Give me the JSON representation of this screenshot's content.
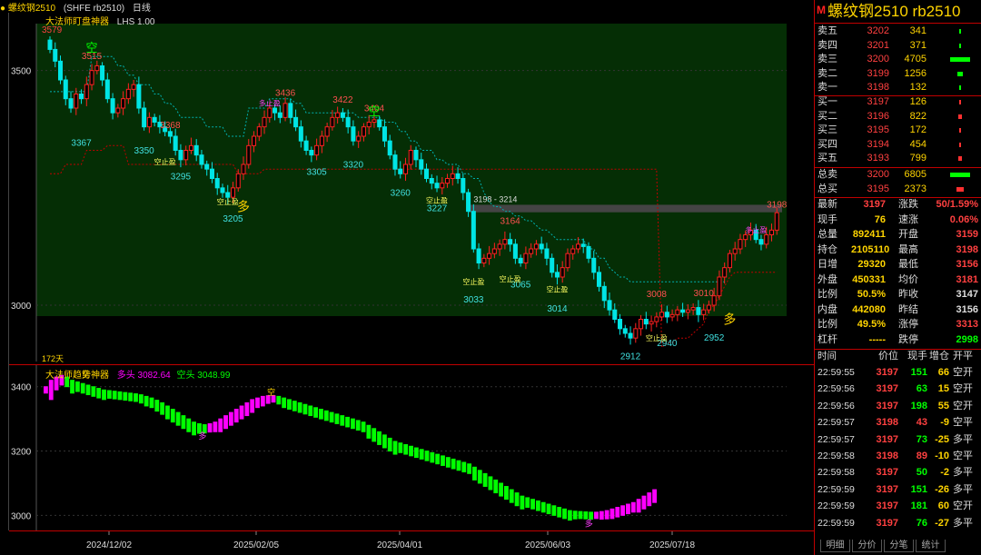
{
  "topbar": {
    "symbol": "● 螺纹钢2510",
    "sup": "M",
    "code": "(SHFE rb2510)",
    "period": "日线"
  },
  "main_legend": {
    "name": "大法师盯盘神器",
    "lhs": "LHS 1.00"
  },
  "sub_legend": {
    "name": "大法师趋势神器",
    "bull_label": "多头 3082.64",
    "bear_label": "空头 3048.99"
  },
  "main_axis": {
    "labels": [
      "3500",
      "3000"
    ],
    "values": [
      3500,
      3000
    ],
    "min": 2880,
    "max": 3600
  },
  "sub_axis": {
    "labels": [
      "3400",
      "3200",
      "3000"
    ],
    "values": [
      3400,
      3200,
      3000
    ],
    "min": 2970,
    "max": 3450
  },
  "date_axis": [
    "2024/12/02",
    "2025/02/05",
    "2025/04/01",
    "2025/06/03",
    "2025/07/18"
  ],
  "chart_annotations": {
    "top_left_price": "3579",
    "days_label": "172天",
    "zone_label": "3198 - 3214",
    "highs": [
      {
        "i": 8,
        "v": "3515"
      },
      {
        "i": 23,
        "v": "3368"
      },
      {
        "i": 45,
        "v": "3436"
      },
      {
        "i": 56,
        "v": "3422"
      },
      {
        "i": 62,
        "v": "3404"
      },
      {
        "i": 88,
        "v": "3164"
      },
      {
        "i": 116,
        "v": "3008"
      },
      {
        "i": 125,
        "v": "3010"
      },
      {
        "i": 139,
        "v": "3198"
      }
    ],
    "lows": [
      {
        "i": 6,
        "v": "3367"
      },
      {
        "i": 18,
        "v": "3350"
      },
      {
        "i": 25,
        "v": "3295"
      },
      {
        "i": 35,
        "v": "3205"
      },
      {
        "i": 51,
        "v": "3305"
      },
      {
        "i": 58,
        "v": "3320"
      },
      {
        "i": 67,
        "v": "3260"
      },
      {
        "i": 74,
        "v": "3227"
      },
      {
        "i": 81,
        "v": "3033"
      },
      {
        "i": 90,
        "v": "3065"
      },
      {
        "i": 97,
        "v": "3014"
      },
      {
        "i": 111,
        "v": "2912"
      },
      {
        "i": 118,
        "v": "2940"
      },
      {
        "i": 127,
        "v": "2952"
      }
    ],
    "signals": {
      "kong": "空",
      "duo": "多",
      "kong_stop": "空止盈",
      "duo_stop": "多止盈"
    }
  },
  "panel": {
    "title": "螺纹钢2510  rb2510",
    "logo": "M",
    "asks": [
      {
        "label": "卖五",
        "price": "3202",
        "vol": "341",
        "bar": 0.05
      },
      {
        "label": "卖四",
        "price": "3201",
        "vol": "371",
        "bar": 0.05
      },
      {
        "label": "卖三",
        "price": "3200",
        "vol": "4705",
        "bar": 0.6
      },
      {
        "label": "卖二",
        "price": "3199",
        "vol": "1256",
        "bar": 0.16
      },
      {
        "label": "卖一",
        "price": "3198",
        "vol": "132",
        "bar": 0.03
      }
    ],
    "bids": [
      {
        "label": "买一",
        "price": "3197",
        "vol": "126",
        "bar": 0.03
      },
      {
        "label": "买二",
        "price": "3196",
        "vol": "822",
        "bar": 0.1
      },
      {
        "label": "买三",
        "price": "3195",
        "vol": "172",
        "bar": 0.03
      },
      {
        "label": "买四",
        "price": "3194",
        "vol": "454",
        "bar": 0.06
      },
      {
        "label": "买五",
        "price": "3193",
        "vol": "799",
        "bar": 0.1
      }
    ],
    "totals": [
      {
        "label": "总卖",
        "price": "3200",
        "vol": "6805",
        "bar": 0.6,
        "color": "#00ff00"
      },
      {
        "label": "总买",
        "price": "3195",
        "vol": "2373",
        "bar": 0.2,
        "color": "#ff3030"
      }
    ],
    "quote": [
      {
        "k1": "最新",
        "v1": "3197",
        "c1": "#ff4040",
        "k2": "涨跌",
        "v2": "50/1.59%",
        "c2": "#ff4040"
      },
      {
        "k1": "现手",
        "v1": "76",
        "c1": "#ffd400",
        "k2": "速涨",
        "v2": "0.06%",
        "c2": "#ff4040"
      },
      {
        "k1": "总量",
        "v1": "892411",
        "c1": "#ffd400",
        "k2": "开盘",
        "v2": "3159",
        "c2": "#ff4040"
      },
      {
        "k1": "持仓",
        "v1": "2105110",
        "c1": "#ffd400",
        "k2": "最高",
        "v2": "3198",
        "c2": "#ff4040"
      },
      {
        "k1": "日增",
        "v1": "29320",
        "c1": "#ffd400",
        "k2": "最低",
        "v2": "3156",
        "c2": "#ff4040"
      },
      {
        "k1": "外盘",
        "v1": "450331",
        "c1": "#ffd400",
        "k2": "均价",
        "v2": "3181",
        "c2": "#ff4040"
      },
      {
        "k1": "比例",
        "v1": "50.5%",
        "c1": "#ffd400",
        "k2": "昨收",
        "v2": "3147",
        "c2": "#ddd"
      },
      {
        "k1": "内盘",
        "v1": "442080",
        "c1": "#ffd400",
        "k2": "昨结",
        "v2": "3156",
        "c2": "#ddd"
      },
      {
        "k1": "比例",
        "v1": "49.5%",
        "c1": "#ffd400",
        "k2": "涨停",
        "v2": "3313",
        "c2": "#ff4040"
      },
      {
        "k1": "杠杆",
        "v1": "-----",
        "c1": "#ffd400",
        "k2": "跌停",
        "v2": "2998",
        "c2": "#00ff00"
      }
    ],
    "ticks_header": [
      "时间",
      "价位",
      "现手",
      "增仓",
      "开平"
    ],
    "ticks": [
      {
        "t": "22:59:55",
        "p": "3197",
        "pc": "#ff4040",
        "v": "151",
        "vc": "#00ff00",
        "d": "66",
        "e": "空开"
      },
      {
        "t": "22:59:56",
        "p": "3197",
        "pc": "#ff4040",
        "v": "63",
        "vc": "#00ff00",
        "d": "15",
        "e": "空开"
      },
      {
        "t": "22:59:56",
        "p": "3197",
        "pc": "#ff4040",
        "v": "198",
        "vc": "#00ff00",
        "d": "55",
        "e": "空开"
      },
      {
        "t": "22:59:57",
        "p": "3198",
        "pc": "#ff4040",
        "v": "43",
        "vc": "#ff4040",
        "d": "-9",
        "e": "空平"
      },
      {
        "t": "22:59:57",
        "p": "3197",
        "pc": "#ff4040",
        "v": "73",
        "vc": "#00ff00",
        "d": "-25",
        "e": "多平"
      },
      {
        "t": "22:59:58",
        "p": "3198",
        "pc": "#ff4040",
        "v": "89",
        "vc": "#ff4040",
        "d": "-10",
        "e": "空平"
      },
      {
        "t": "22:59:58",
        "p": "3197",
        "pc": "#ff4040",
        "v": "50",
        "vc": "#00ff00",
        "d": "-2",
        "e": "多平"
      },
      {
        "t": "22:59:59",
        "p": "3197",
        "pc": "#ff4040",
        "v": "151",
        "vc": "#00ff00",
        "d": "-26",
        "e": "多平"
      },
      {
        "t": "22:59:59",
        "p": "3197",
        "pc": "#ff4040",
        "v": "181",
        "vc": "#00ff00",
        "d": "60",
        "e": "空开"
      },
      {
        "t": "22:59:59",
        "p": "3197",
        "pc": "#ff4040",
        "v": "76",
        "vc": "#00ff00",
        "d": "-27",
        "e": "多平"
      }
    ],
    "tabs": [
      "明细",
      "分价",
      "分笔",
      "统计"
    ]
  },
  "colors": {
    "bg_green": "#052e05",
    "up": "#ff2020",
    "down": "#00e5e5",
    "stop": "#c00000",
    "bull": "#ff00ff",
    "bear": "#00ff00"
  },
  "chart_data": {
    "type": "candlestick",
    "closes": [
      3545,
      3520,
      3480,
      3440,
      3420,
      3450,
      3440,
      3470,
      3500,
      3510,
      3480,
      3440,
      3410,
      3420,
      3440,
      3460,
      3470,
      3420,
      3380,
      3400,
      3390,
      3380,
      3370,
      3360,
      3330,
      3310,
      3330,
      3340,
      3320,
      3300,
      3290,
      3270,
      3250,
      3240,
      3230,
      3250,
      3280,
      3300,
      3340,
      3360,
      3380,
      3400,
      3420,
      3410,
      3400,
      3430,
      3400,
      3380,
      3350,
      3330,
      3320,
      3340,
      3360,
      3380,
      3400,
      3410,
      3400,
      3380,
      3350,
      3360,
      3380,
      3390,
      3395,
      3380,
      3350,
      3320,
      3290,
      3280,
      3300,
      3330,
      3310,
      3290,
      3270,
      3260,
      3250,
      3260,
      3270,
      3280,
      3270,
      3240,
      3200,
      3120,
      3090,
      3100,
      3110,
      3120,
      3130,
      3140,
      3130,
      3100,
      3090,
      3110,
      3120,
      3130,
      3120,
      3100,
      3070,
      3060,
      3080,
      3110,
      3120,
      3130,
      3125,
      3100,
      3070,
      3040,
      3010,
      2990,
      2970,
      2950,
      2940,
      2930,
      2950,
      2970,
      2960,
      2965,
      2975,
      2985,
      2975,
      2980,
      2990,
      2985,
      2990,
      2995,
      2980,
      2990,
      3000,
      3020,
      3060,
      3080,
      3110,
      3120,
      3140,
      3150,
      3160,
      3140,
      3130,
      3150,
      3160,
      3197
    ],
    "stop_line_bear": [
      3455,
      3455,
      3455,
      3455,
      3455,
      3455,
      3455,
      3455,
      3530,
      3530,
      3530,
      3530,
      3530,
      3510,
      3510,
      3490,
      3490,
      3470,
      3470,
      3470,
      3450,
      3450,
      3430,
      3430,
      3420,
      3400,
      3400,
      3400,
      3400,
      3400,
      3380,
      3380,
      3380,
      3380,
      3360,
      3360,
      3360,
      3360,
      3420,
      3420,
      3420,
      3420,
      3440,
      3440,
      3440,
      3440,
      3440,
      3430,
      3430,
      3410,
      3410,
      3410,
      3410,
      3410,
      3410,
      3410,
      3410,
      3410,
      3410,
      3400,
      3400,
      3400,
      3400,
      3400,
      3390,
      3390,
      3390,
      3370,
      3370,
      3350,
      3350,
      3330,
      3330,
      3330,
      3310,
      3310,
      3300,
      3300,
      3300,
      3280,
      3280,
      3270,
      3270,
      3240,
      3220,
      3210,
      3210,
      3200,
      3200,
      3190,
      3190,
      3180,
      3180,
      3170,
      3160,
      3160,
      3150,
      3140,
      3140,
      3140,
      3140,
      3140,
      3140,
      3120,
      3120,
      3100,
      3100,
      3080,
      3070,
      3060,
      3060,
      3050,
      3050,
      3050,
      3050,
      3050,
      3050,
      3050,
      3050,
      3050,
      3050,
      3050,
      3050,
      3050,
      3050,
      3050,
      3050,
      3050,
      3050,
      3050
    ],
    "stop_line_bull": [
      3280,
      3280,
      3280,
      3300,
      3300,
      3300,
      3300,
      3330,
      3330,
      3330,
      3330,
      3340,
      3340,
      3340,
      3340,
      3300,
      3300,
      3300,
      3300,
      3300,
      3300,
      3300,
      3300,
      3300,
      3300,
      3300,
      3300,
      3300,
      3300,
      3300,
      3300,
      3300,
      3300,
      3300,
      3300,
      3300,
      3280,
      3280,
      3280,
      3280,
      3280,
      3290,
      3290,
      3290,
      3290,
      3290,
      3290,
      3290,
      3290,
      3290,
      3290,
      3290,
      3290,
      3290,
      3290,
      3290,
      3290,
      3290,
      3290,
      3290,
      3290,
      3290,
      3290,
      3290,
      3290,
      3290,
      3290,
      3290,
      3290,
      3290,
      3290,
      3290,
      3290,
      3290,
      3290,
      3290,
      3290,
      3290,
      3290,
      3290,
      3290,
      3290,
      3290,
      3290,
      3290,
      3290,
      3290,
      3290,
      3290,
      3290,
      3290,
      3290,
      3290,
      3290,
      3290,
      3290,
      3290,
      3290,
      3290,
      3290,
      3290,
      3290,
      3290,
      3290,
      3290,
      3290,
      3290,
      3290,
      3290,
      3290,
      3290,
      3290,
      3290,
      3290,
      3290,
      3290,
      3290,
      2910,
      2920,
      2920,
      2930,
      2930,
      2930,
      2940,
      2950,
      2960,
      2990,
      3000,
      3020,
      3040,
      3060,
      3070,
      3070,
      3070,
      3070,
      3070,
      3070,
      3070,
      3070,
      3070,
      3070
    ],
    "trend": [
      3390,
      3410,
      3420,
      3425,
      3420,
      3410,
      3405,
      3400,
      3395,
      3390,
      3385,
      3380,
      3378,
      3376,
      3374,
      3372,
      3370,
      3368,
      3365,
      3360,
      3355,
      3348,
      3340,
      3330,
      3320,
      3310,
      3300,
      3290,
      3280,
      3275,
      3272,
      3275,
      3280,
      3290,
      3300,
      3310,
      3320,
      3330,
      3340,
      3350,
      3355,
      3360,
      3362,
      3362,
      3360,
      3355,
      3350,
      3345,
      3340,
      3335,
      3330,
      3325,
      3320,
      3315,
      3310,
      3305,
      3300,
      3295,
      3290,
      3285,
      3280,
      3270,
      3260,
      3250,
      3240,
      3230,
      3220,
      3215,
      3210,
      3205,
      3200,
      3195,
      3190,
      3185,
      3180,
      3175,
      3170,
      3165,
      3160,
      3155,
      3150,
      3140,
      3130,
      3120,
      3110,
      3100,
      3090,
      3080,
      3070,
      3060,
      3050,
      3045,
      3040,
      3035,
      3030,
      3025,
      3020,
      3015,
      3010,
      3005,
      3003,
      3002,
      3001,
      3000,
      3000,
      3002,
      3005,
      3010,
      3015,
      3020,
      3025,
      3030,
      3040,
      3050,
      3060,
      3070
    ],
    "trend_signal_kong": "空",
    "trend_signal_duo": "多"
  }
}
